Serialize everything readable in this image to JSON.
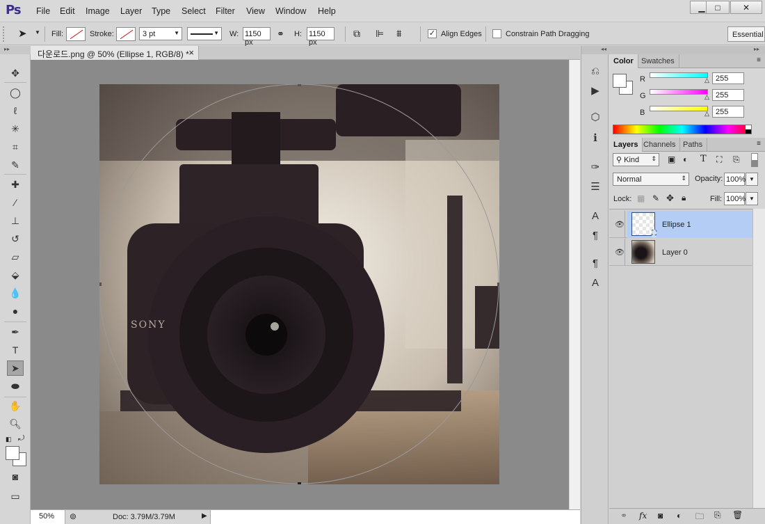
{
  "app": {
    "logo": "Ps"
  },
  "menu": [
    "File",
    "Edit",
    "Image",
    "Layer",
    "Type",
    "Select",
    "Filter",
    "View",
    "Window",
    "Help"
  ],
  "window_buttons": {
    "minimize": "▁",
    "maximize": "□",
    "close": "✕"
  },
  "options": {
    "fill_label": "Fill:",
    "stroke_label": "Stroke:",
    "stroke_width": "3 pt",
    "w_label": "W:",
    "w_value": "1150 px",
    "h_label": "H:",
    "h_value": "1150 px",
    "align_edges_label": "Align Edges",
    "align_edges_checked": "✓",
    "constrain_label": "Constrain Path Dragging",
    "workspace": "Essential"
  },
  "document": {
    "tab_title": "다운로드.png @ 50% (Ellipse 1, RGB/8) *",
    "tab_close": "×",
    "photo_brand": "SONY"
  },
  "status": {
    "zoom": "50%",
    "doc": "Doc: 3.79M/3.79M"
  },
  "color_panel": {
    "tabs": [
      "Color",
      "Swatches"
    ],
    "channels": [
      {
        "label": "R",
        "value": "255",
        "gradient_end": "#00ffff"
      },
      {
        "label": "G",
        "value": "255",
        "gradient_end": "#ff00ff"
      },
      {
        "label": "B",
        "value": "255",
        "gradient_end": "#ffff00"
      }
    ]
  },
  "layers_panel": {
    "tabs": [
      "Layers",
      "Channels",
      "Paths"
    ],
    "filter_kind": "Kind",
    "blend_mode": "Normal",
    "opacity_label": "Opacity:",
    "opacity_value": "100%",
    "lock_label": "Lock:",
    "fill_label": "Fill:",
    "fill_value": "100%",
    "layers": [
      {
        "name": "Ellipse 1",
        "selected": true
      },
      {
        "name": "Layer 0",
        "selected": false
      }
    ],
    "selected_color": "#b3cdf5"
  }
}
